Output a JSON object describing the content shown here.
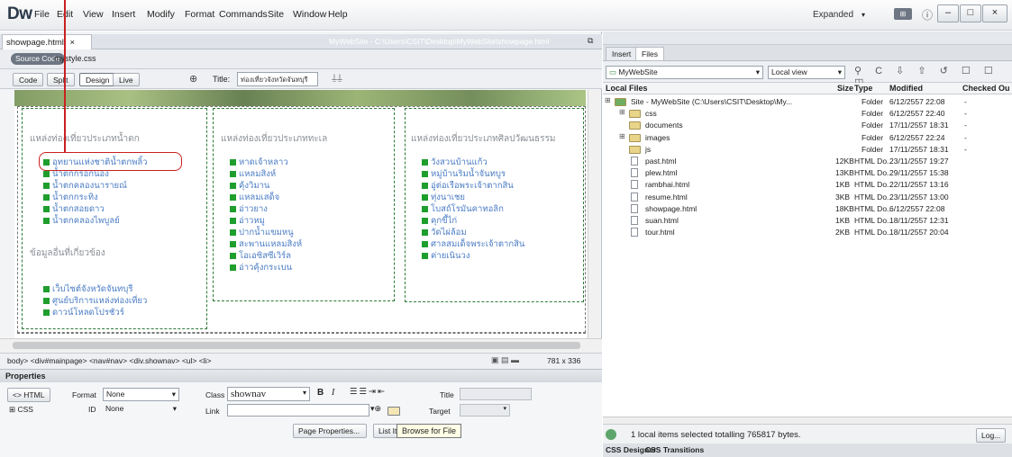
{
  "app": {
    "logo": "Dw",
    "workspace": "Expanded"
  },
  "menu": [
    "File",
    "Edit",
    "View",
    "Insert",
    "Modify",
    "Format",
    "Commands",
    "Site",
    "Window",
    "Help"
  ],
  "window_buttons": {
    "min": "–",
    "max": "□",
    "close": "×"
  },
  "doc": {
    "tab": "showpage.html",
    "tab_close": "×",
    "path": "MyWebSite - C:\\Users\\CSIT\\Desktop\\MyWebSite\\showpage.html",
    "source_code": "Source Code",
    "related_file": "mystyle.css",
    "views": [
      "Code",
      "Split",
      "Design",
      "Live"
    ],
    "title_label": "Title:",
    "title_value": "ท่องเที่ยวจังหวัดจันทบุรี"
  },
  "design": {
    "col1_title": "แหล่งท่องเที่ยวประเภทน้ำตก",
    "col1_items": [
      "อุทยานแห่งชาติน้ำตกพลิ้ว",
      "น้ำตกกรอกนอง",
      "น้ำตกคลองนารายณ์",
      "น้ำตกกระทิง",
      "น้ำตกสอยดาว",
      "น้ำตกคลองไพบูลย์"
    ],
    "col1_sub_title": "ข้อมูลอื่นที่เกี่ยวข้อง",
    "col1_sub_items": [
      "เว็บไซต์จังหวัดจันทบุรี",
      "ศูนย์บริการแหล่งท่องเที่ยว",
      "ดาวน์โหลดโปรชัวร์"
    ],
    "col2_title": "แหล่งท่องเที่ยวประเภททะเล",
    "col2_items": [
      "หาดเจ้าหลาว",
      "แหลมสิงห์",
      "คุ้งวิมาน",
      "แหลมเสด็จ",
      "อ่าวยาง",
      "อ่าวหมู",
      "ปากน้ำแขมหนู",
      "สะพานแหลมสิงห์",
      "โอเอซิสซีเวิร์ล",
      "อ่าวคุ้งกระเบน"
    ],
    "col3_title": "แหล่งท่องเที่ยวประเภทศิลปวัฒนธรรม",
    "col3_items": [
      "วังสวนบ้านแก้ว",
      "หมู่บ้านริมน้ำจันทบูร",
      "อู่ต่อเรือพระเจ้าตากสิน",
      "ทุ่งนาเชย",
      "โบสถ์โรมันคาทอลิก",
      "คุกขี้ไก่",
      "วัดไผ่ล้อม",
      "ศาลสมเด็จพระเจ้าตากสิน",
      "ค่ายเนินวง"
    ]
  },
  "tagbar": {
    "path": "body> <div#mainpage> <nav#nav> <div.shownav> <ul> <li>",
    "size": "781 x 336"
  },
  "properties": {
    "header": "Properties",
    "html_btn": "HTML",
    "css_btn": "CSS",
    "format_label": "Format",
    "format_value": "None",
    "id_label": "ID",
    "id_value": "None",
    "class_label": "Class",
    "class_value": "shownav",
    "link_label": "Link",
    "title_label": "Title",
    "target_label": "Target",
    "page_props": "Page Properties...",
    "list_item": "List Item...",
    "tooltip": "Browse for File"
  },
  "files_panel": {
    "tabs": [
      "Insert",
      "Files"
    ],
    "site": "MyWebSite",
    "view": "Local view",
    "columns": [
      "Local Files",
      "Size",
      "Type",
      "Modified",
      "Checked Ou"
    ],
    "rows": [
      {
        "name": "Site - MyWebSite (C:\\Users\\CSIT\\Desktop\\My...",
        "size": "",
        "type": "Folder",
        "modified": "6/12/2557 22:08",
        "checked": "-",
        "kind": "site",
        "indent": 0
      },
      {
        "name": "css",
        "size": "",
        "type": "Folder",
        "modified": "6/12/2557 22:40",
        "checked": "-",
        "kind": "folder",
        "indent": 1
      },
      {
        "name": "documents",
        "size": "",
        "type": "Folder",
        "modified": "17/11/2557 18:31",
        "checked": "-",
        "kind": "folder",
        "indent": 1
      },
      {
        "name": "images",
        "size": "",
        "type": "Folder",
        "modified": "6/12/2557 22:24",
        "checked": "-",
        "kind": "folder",
        "indent": 1
      },
      {
        "name": "js",
        "size": "",
        "type": "Folder",
        "modified": "17/11/2557 18:31",
        "checked": "-",
        "kind": "folder",
        "indent": 1
      },
      {
        "name": "past.html",
        "size": "12KB",
        "type": "HTML Do...",
        "modified": "23/11/2557 19:27",
        "checked": "",
        "kind": "file",
        "indent": 1
      },
      {
        "name": "plew.html",
        "size": "13KB",
        "type": "HTML Do...",
        "modified": "29/11/2557 15:38",
        "checked": "",
        "kind": "file",
        "indent": 1
      },
      {
        "name": "rambhai.html",
        "size": "1KB",
        "type": "HTML Do...",
        "modified": "22/11/2557 13:16",
        "checked": "",
        "kind": "file",
        "indent": 1
      },
      {
        "name": "resume.html",
        "size": "3KB",
        "type": "HTML Do...",
        "modified": "23/11/2557 13:00",
        "checked": "",
        "kind": "file",
        "indent": 1
      },
      {
        "name": "showpage.html",
        "size": "18KB",
        "type": "HTML Do...",
        "modified": "6/12/2557 22:08",
        "checked": "",
        "kind": "file",
        "indent": 1
      },
      {
        "name": "suan.html",
        "size": "1KB",
        "type": "HTML Do...",
        "modified": "18/11/2557 12:31",
        "checked": "",
        "kind": "file",
        "indent": 1
      },
      {
        "name": "tour.html",
        "size": "2KB",
        "type": "HTML Do...",
        "modified": "18/11/2557 20:04",
        "checked": "",
        "kind": "file",
        "indent": 1
      }
    ],
    "status": "1 local items selected totalling 765817 bytes.",
    "log_btn": "Log...",
    "bottom_tabs": [
      "CSS Designer",
      "CSS Transitions"
    ]
  },
  "colors": {
    "accent_red": "#c92020",
    "bullet_green": "#1f9e2e",
    "link_blue": "#4a7cc3",
    "box_border": "#2d7a3a"
  }
}
